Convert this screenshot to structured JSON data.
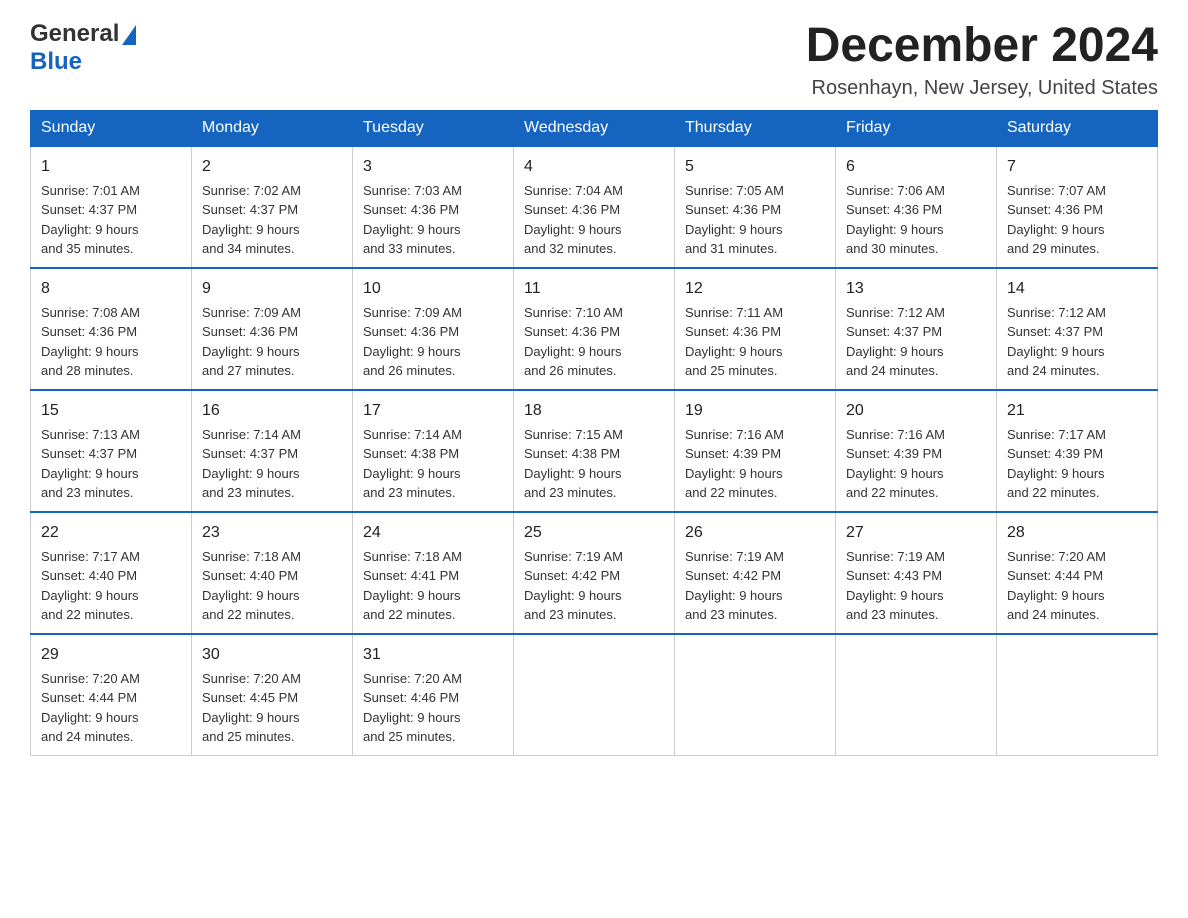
{
  "header": {
    "logo_general": "General",
    "logo_blue": "Blue",
    "title": "December 2024",
    "subtitle": "Rosenhayn, New Jersey, United States"
  },
  "weekdays": [
    "Sunday",
    "Monday",
    "Tuesday",
    "Wednesday",
    "Thursday",
    "Friday",
    "Saturday"
  ],
  "weeks": [
    [
      {
        "day": "1",
        "sunrise": "7:01 AM",
        "sunset": "4:37 PM",
        "daylight": "9 hours and 35 minutes."
      },
      {
        "day": "2",
        "sunrise": "7:02 AM",
        "sunset": "4:37 PM",
        "daylight": "9 hours and 34 minutes."
      },
      {
        "day": "3",
        "sunrise": "7:03 AM",
        "sunset": "4:36 PM",
        "daylight": "9 hours and 33 minutes."
      },
      {
        "day": "4",
        "sunrise": "7:04 AM",
        "sunset": "4:36 PM",
        "daylight": "9 hours and 32 minutes."
      },
      {
        "day": "5",
        "sunrise": "7:05 AM",
        "sunset": "4:36 PM",
        "daylight": "9 hours and 31 minutes."
      },
      {
        "day": "6",
        "sunrise": "7:06 AM",
        "sunset": "4:36 PM",
        "daylight": "9 hours and 30 minutes."
      },
      {
        "day": "7",
        "sunrise": "7:07 AM",
        "sunset": "4:36 PM",
        "daylight": "9 hours and 29 minutes."
      }
    ],
    [
      {
        "day": "8",
        "sunrise": "7:08 AM",
        "sunset": "4:36 PM",
        "daylight": "9 hours and 28 minutes."
      },
      {
        "day": "9",
        "sunrise": "7:09 AM",
        "sunset": "4:36 PM",
        "daylight": "9 hours and 27 minutes."
      },
      {
        "day": "10",
        "sunrise": "7:09 AM",
        "sunset": "4:36 PM",
        "daylight": "9 hours and 26 minutes."
      },
      {
        "day": "11",
        "sunrise": "7:10 AM",
        "sunset": "4:36 PM",
        "daylight": "9 hours and 26 minutes."
      },
      {
        "day": "12",
        "sunrise": "7:11 AM",
        "sunset": "4:36 PM",
        "daylight": "9 hours and 25 minutes."
      },
      {
        "day": "13",
        "sunrise": "7:12 AM",
        "sunset": "4:37 PM",
        "daylight": "9 hours and 24 minutes."
      },
      {
        "day": "14",
        "sunrise": "7:12 AM",
        "sunset": "4:37 PM",
        "daylight": "9 hours and 24 minutes."
      }
    ],
    [
      {
        "day": "15",
        "sunrise": "7:13 AM",
        "sunset": "4:37 PM",
        "daylight": "9 hours and 23 minutes."
      },
      {
        "day": "16",
        "sunrise": "7:14 AM",
        "sunset": "4:37 PM",
        "daylight": "9 hours and 23 minutes."
      },
      {
        "day": "17",
        "sunrise": "7:14 AM",
        "sunset": "4:38 PM",
        "daylight": "9 hours and 23 minutes."
      },
      {
        "day": "18",
        "sunrise": "7:15 AM",
        "sunset": "4:38 PM",
        "daylight": "9 hours and 23 minutes."
      },
      {
        "day": "19",
        "sunrise": "7:16 AM",
        "sunset": "4:39 PM",
        "daylight": "9 hours and 22 minutes."
      },
      {
        "day": "20",
        "sunrise": "7:16 AM",
        "sunset": "4:39 PM",
        "daylight": "9 hours and 22 minutes."
      },
      {
        "day": "21",
        "sunrise": "7:17 AM",
        "sunset": "4:39 PM",
        "daylight": "9 hours and 22 minutes."
      }
    ],
    [
      {
        "day": "22",
        "sunrise": "7:17 AM",
        "sunset": "4:40 PM",
        "daylight": "9 hours and 22 minutes."
      },
      {
        "day": "23",
        "sunrise": "7:18 AM",
        "sunset": "4:40 PM",
        "daylight": "9 hours and 22 minutes."
      },
      {
        "day": "24",
        "sunrise": "7:18 AM",
        "sunset": "4:41 PM",
        "daylight": "9 hours and 22 minutes."
      },
      {
        "day": "25",
        "sunrise": "7:19 AM",
        "sunset": "4:42 PM",
        "daylight": "9 hours and 23 minutes."
      },
      {
        "day": "26",
        "sunrise": "7:19 AM",
        "sunset": "4:42 PM",
        "daylight": "9 hours and 23 minutes."
      },
      {
        "day": "27",
        "sunrise": "7:19 AM",
        "sunset": "4:43 PM",
        "daylight": "9 hours and 23 minutes."
      },
      {
        "day": "28",
        "sunrise": "7:20 AM",
        "sunset": "4:44 PM",
        "daylight": "9 hours and 24 minutes."
      }
    ],
    [
      {
        "day": "29",
        "sunrise": "7:20 AM",
        "sunset": "4:44 PM",
        "daylight": "9 hours and 24 minutes."
      },
      {
        "day": "30",
        "sunrise": "7:20 AM",
        "sunset": "4:45 PM",
        "daylight": "9 hours and 25 minutes."
      },
      {
        "day": "31",
        "sunrise": "7:20 AM",
        "sunset": "4:46 PM",
        "daylight": "9 hours and 25 minutes."
      },
      null,
      null,
      null,
      null
    ]
  ],
  "labels": {
    "sunrise_prefix": "Sunrise: ",
    "sunset_prefix": "Sunset: ",
    "daylight_prefix": "Daylight: "
  }
}
